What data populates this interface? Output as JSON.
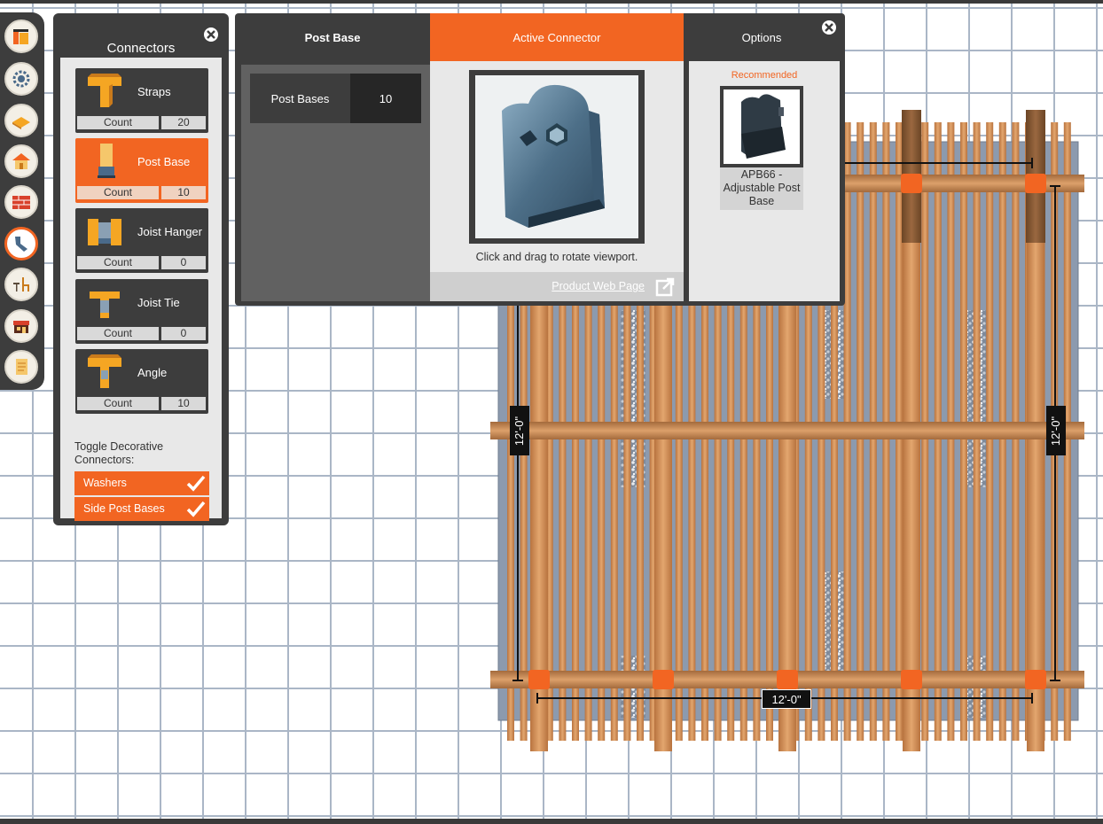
{
  "toolbar": {
    "buttons": [
      {
        "name": "layout",
        "icon": "deck-layout-icon"
      },
      {
        "name": "settings",
        "icon": "gear-icon"
      },
      {
        "name": "decking",
        "icon": "lumber-icon"
      },
      {
        "name": "structure",
        "icon": "house-icon"
      },
      {
        "name": "materials",
        "icon": "brick-icon"
      },
      {
        "name": "connectors",
        "icon": "connector-icon",
        "active": true
      },
      {
        "name": "furniture",
        "icon": "chairs-icon"
      },
      {
        "name": "store",
        "icon": "store-icon"
      },
      {
        "name": "report",
        "icon": "document-icon"
      }
    ]
  },
  "connectors_panel": {
    "title": "Connectors",
    "cards": [
      {
        "name": "Straps",
        "count_label": "Count",
        "count": "20",
        "active": false
      },
      {
        "name": "Post Base",
        "count_label": "Count",
        "count": "10",
        "active": true
      },
      {
        "name": "Joist Hanger",
        "count_label": "Count",
        "count": "0",
        "active": false
      },
      {
        "name": "Joist Tie",
        "count_label": "Count",
        "count": "0",
        "active": false
      },
      {
        "name": "Angle",
        "count_label": "Count",
        "count": "10",
        "active": false
      }
    ],
    "toggle_label": "Toggle Decorative Connectors:",
    "toggles": [
      {
        "label": "Washers",
        "checked": true
      },
      {
        "label": "Side Post Bases",
        "checked": true
      }
    ]
  },
  "detail_panel": {
    "tabs": {
      "post_base": "Post Base",
      "active_connector": "Active Connector",
      "options": "Options"
    },
    "post_bases_label": "Post Bases",
    "post_bases_count": "10",
    "rotate_hint": "Click and drag to rotate viewport.",
    "web_link": "Product Web Page",
    "recommended_label": "Recommended",
    "recommended_name": "APB66 - Adjustable Post Base"
  },
  "deck": {
    "dim_left": "12'-0\"",
    "dim_right": "12'-0\"",
    "dim_bottom": "12'-0\""
  },
  "colors": {
    "accent": "#f26522",
    "panel": "#3d3d3d",
    "grid": "#aab6c6",
    "wood": "#d9955a"
  }
}
